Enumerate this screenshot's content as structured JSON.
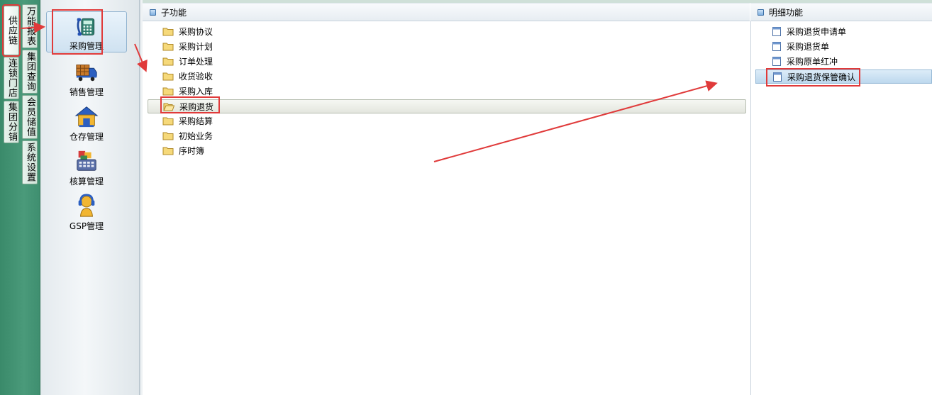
{
  "rail": {
    "tabs_a": [
      "供应链",
      "连锁门店",
      "集团分销"
    ],
    "tabs_b": [
      "万能报表",
      "集团查询",
      "会员储值",
      "系统设置"
    ]
  },
  "modules": [
    {
      "label": "采购管理",
      "icon": "phone-calculator-icon",
      "selected": true
    },
    {
      "label": "销售管理",
      "icon": "delivery-truck-icon"
    },
    {
      "label": "仓存管理",
      "icon": "warehouse-house-icon"
    },
    {
      "label": "核算管理",
      "icon": "cash-register-icon"
    },
    {
      "label": "GSP管理",
      "icon": "support-agent-icon"
    }
  ],
  "subfunctions": {
    "title": "子功能",
    "items": [
      "采购协议",
      "采购计划",
      "订单处理",
      "收货验收",
      "采购入库",
      "采购退货",
      "采购结算",
      "初始业务",
      "序时簿"
    ],
    "selected_index": 5
  },
  "details": {
    "title": "明细功能",
    "items": [
      "采购退货申请单",
      "采购退货单",
      "采购原单红冲",
      "采购退货保管确认"
    ],
    "selected_index": 3
  },
  "colors": {
    "rail_green": "#3f8f70",
    "annotation_red": "#e03a3a",
    "selected_blue": "#cfe2f1"
  }
}
